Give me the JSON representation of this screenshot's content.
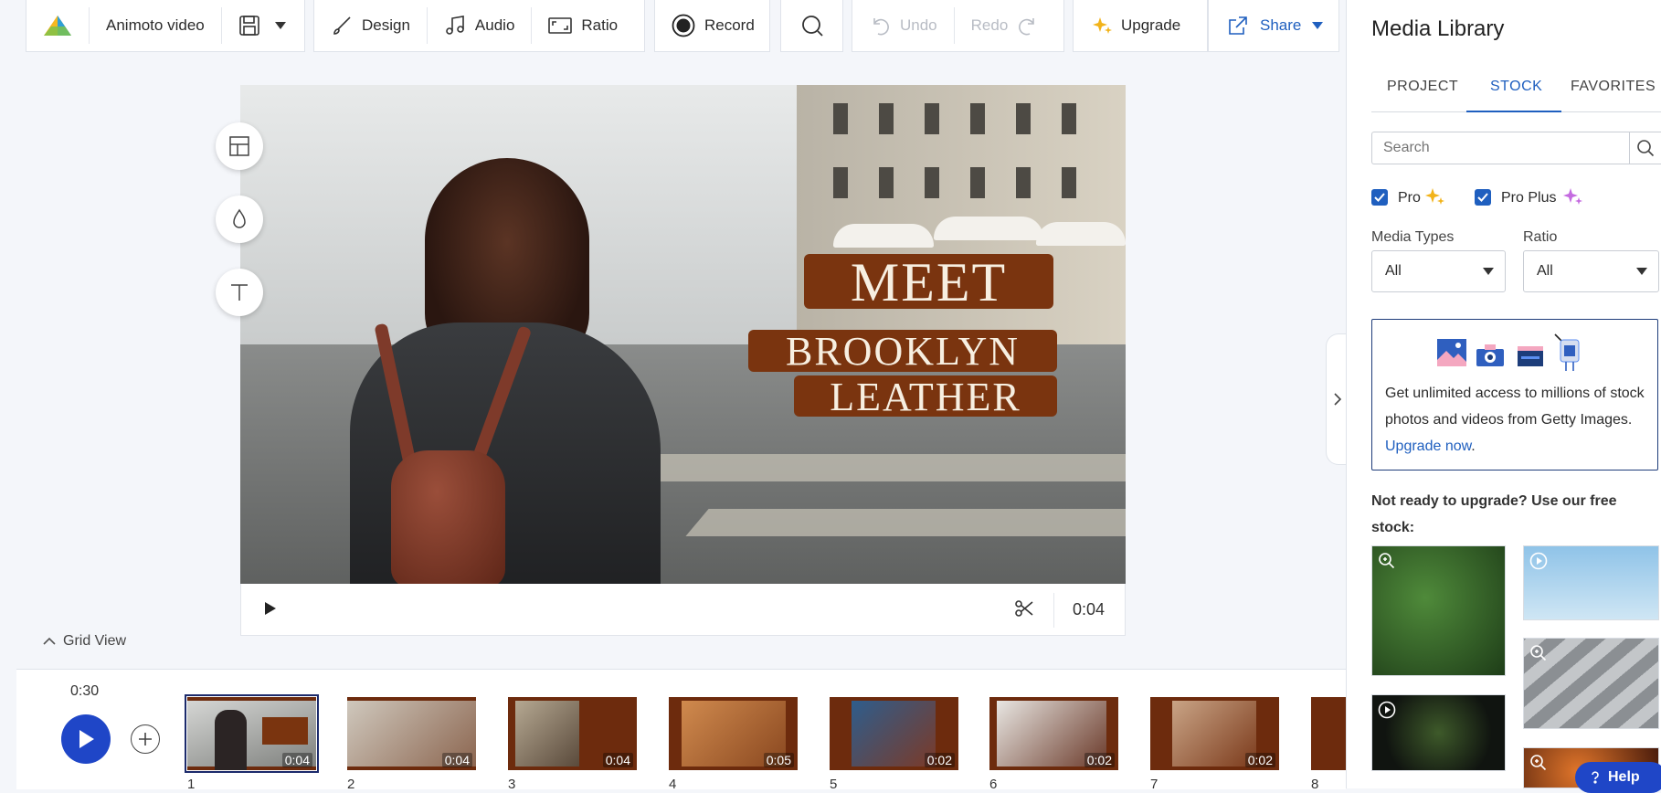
{
  "toolbar": {
    "project_name": "Animoto video",
    "design_label": "Design",
    "audio_label": "Audio",
    "ratio_label": "Ratio",
    "record_label": "Record",
    "undo_label": "Undo",
    "redo_label": "Redo",
    "upgrade_label": "Upgrade",
    "share_label": "Share"
  },
  "preview": {
    "title_lines": [
      "MEET",
      "BROOKLYN",
      "LEATHER"
    ],
    "time": "0:04"
  },
  "grid_view_label": "Grid View",
  "timeline": {
    "total_time": "0:30",
    "clips": [
      {
        "num": "1",
        "duration": "0:04",
        "selected": true
      },
      {
        "num": "2",
        "duration": "0:04"
      },
      {
        "num": "3",
        "duration": "0:04"
      },
      {
        "num": "4",
        "duration": "0:05"
      },
      {
        "num": "5",
        "duration": "0:02"
      },
      {
        "num": "6",
        "duration": "0:02"
      },
      {
        "num": "7",
        "duration": "0:02"
      },
      {
        "num": "8",
        "duration": ""
      }
    ]
  },
  "media_library": {
    "title": "Media Library",
    "tabs": [
      "PROJECT",
      "STOCK",
      "FAVORITES"
    ],
    "active_tab": "STOCK",
    "search_placeholder": "Search",
    "pro_label": "Pro",
    "pro_plus_label": "Pro Plus",
    "media_types_label": "Media Types",
    "media_types_value": "All",
    "ratio_label": "Ratio",
    "ratio_value": "All",
    "promo_text": "Get unlimited access to millions of stock photos and videos from Getty Images.",
    "promo_link": "Upgrade now",
    "promo_end": ".",
    "free_stock_text": "Not ready to upgrade? Use our free stock:",
    "help_label": "Help"
  },
  "colors": {
    "accent": "#1f5fbf",
    "banner": "#7a340f",
    "play_button": "#1f46c7"
  }
}
